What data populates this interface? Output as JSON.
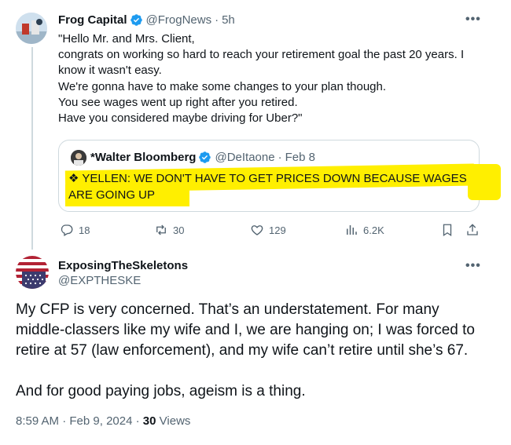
{
  "main_tweet": {
    "author_name": "Frog Capital",
    "handle": "@FrogNews",
    "separator": "·",
    "time": "5h",
    "more_label": "•••",
    "text": "\"Hello Mr. and Mrs. Client,\ncongrats on working so hard to reach your retirement goal the past 20 years. I know it wasn't easy.\nWe're gonna have to make some changes to your plan though.\nYou see wages went up right after you retired.\nHave you considered maybe driving for Uber?\"",
    "quote": {
      "author_name": "*Walter Bloomberg",
      "handle": "@DeItaone",
      "separator": "·",
      "date": "Feb 8",
      "text": "❖ YELLEN: WE DON'T HAVE TO GET PRICES DOWN BECAUSE WAGES ARE GOING UP",
      "highlight_color": "#ffef00"
    },
    "actions": {
      "replies": "18",
      "reposts": "30",
      "likes": "129",
      "views": "6.2K"
    }
  },
  "reply_tweet": {
    "author_name": "ExposingTheSkeletons",
    "handle": "@EXPTHESKE",
    "more_label": "•••",
    "paragraphs": [
      "My CFP is very concerned. That’s an understatement. For many middle-classers like my wife and I, we are hanging on; I was forced to retire at 57 (law enforcement), and my wife can’t retire until she’s 67.",
      "And for good paying jobs, ageism is a thing."
    ],
    "time": "8:59 AM",
    "date": "Feb 9, 2024",
    "separator": "·",
    "views_count": "30",
    "views_label": "Views"
  },
  "colors": {
    "verified_blue": "#1d9bf0",
    "muted": "#536471",
    "border": "#cfd9de"
  }
}
